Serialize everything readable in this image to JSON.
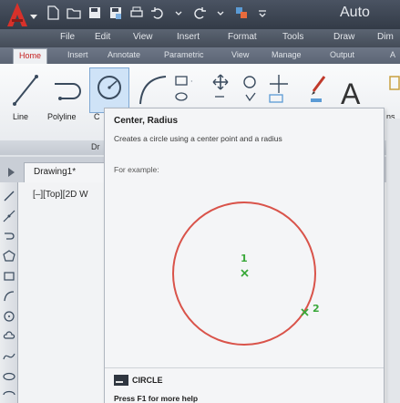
{
  "app": {
    "title": "Auto"
  },
  "menu": [
    "File",
    "Edit",
    "View",
    "Insert",
    "Format",
    "Tools",
    "Draw",
    "Dim"
  ],
  "ribbon_tabs": [
    "Home",
    "Insert",
    "Annotate",
    "Parametric",
    "View",
    "Manage",
    "Output",
    "A"
  ],
  "ribbon": {
    "line_label": "Line",
    "polyline_label": "Polyline",
    "circle_label_partial": "C",
    "panel_title_partial": "Dr",
    "right_partial_label": "ns"
  },
  "document": {
    "tab_title": "Drawing1*",
    "viewport_label": "[–][Top][2D W"
  },
  "tooltip": {
    "title": "Center, Radius",
    "description": "Creates a circle using a center point and a radius",
    "example_label": "For example:",
    "marker_1": "1",
    "marker_2": "2",
    "command": "CIRCLE",
    "help": "Press F1 for more help"
  },
  "colors": {
    "accent_red": "#c62020",
    "circle_stroke": "#d9534a",
    "marker_green": "#3aa83a"
  }
}
